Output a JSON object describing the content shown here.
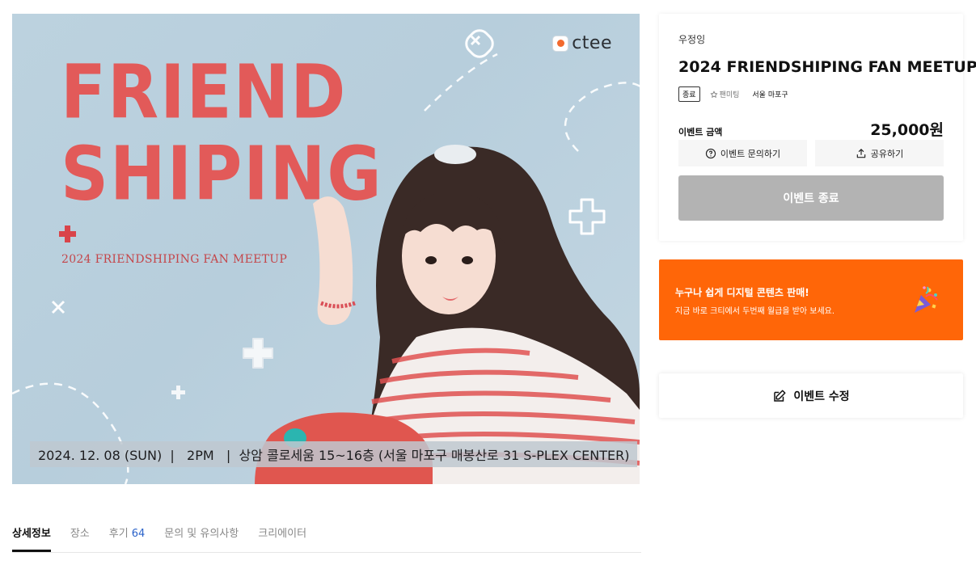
{
  "poster": {
    "brand": "ctee",
    "title_line1": "FRIEND",
    "title_line2": "SHIPING",
    "subtitle": "2024 FRIENDSHIPING FAN MEETUP",
    "info": "2024. 12. 08 (SUN)  |   2PM   |  상암 콜로세움 15~16층 (서울 마포구 매봉산로 31 S-PLEX CENTER)"
  },
  "tabs": [
    {
      "label": "상세정보"
    },
    {
      "label": "장소"
    },
    {
      "label": "후기",
      "count": "64"
    },
    {
      "label": "문의 및 유의사항"
    },
    {
      "label": "크리에이터"
    }
  ],
  "card": {
    "creator": "우정잉",
    "title": "2024 FRIENDSHIPING FAN MEETUP",
    "tags": {
      "status": "종료",
      "category": "팬미팅",
      "location": "서울 마포구"
    },
    "price_label": "이벤트 금액",
    "price": "25,000원",
    "inquiry_label": "이벤트 문의하기",
    "share_label": "공유하기",
    "ended_label": "이벤트 종료"
  },
  "promo": {
    "headline": "누구나 쉽게 디지털 콘텐츠 판매!",
    "sub": "지금 바로 크티에서 두번째 월급을 받아 보세요.",
    "accent": "#ff6608"
  },
  "edit": {
    "label": "이벤트 수정"
  }
}
